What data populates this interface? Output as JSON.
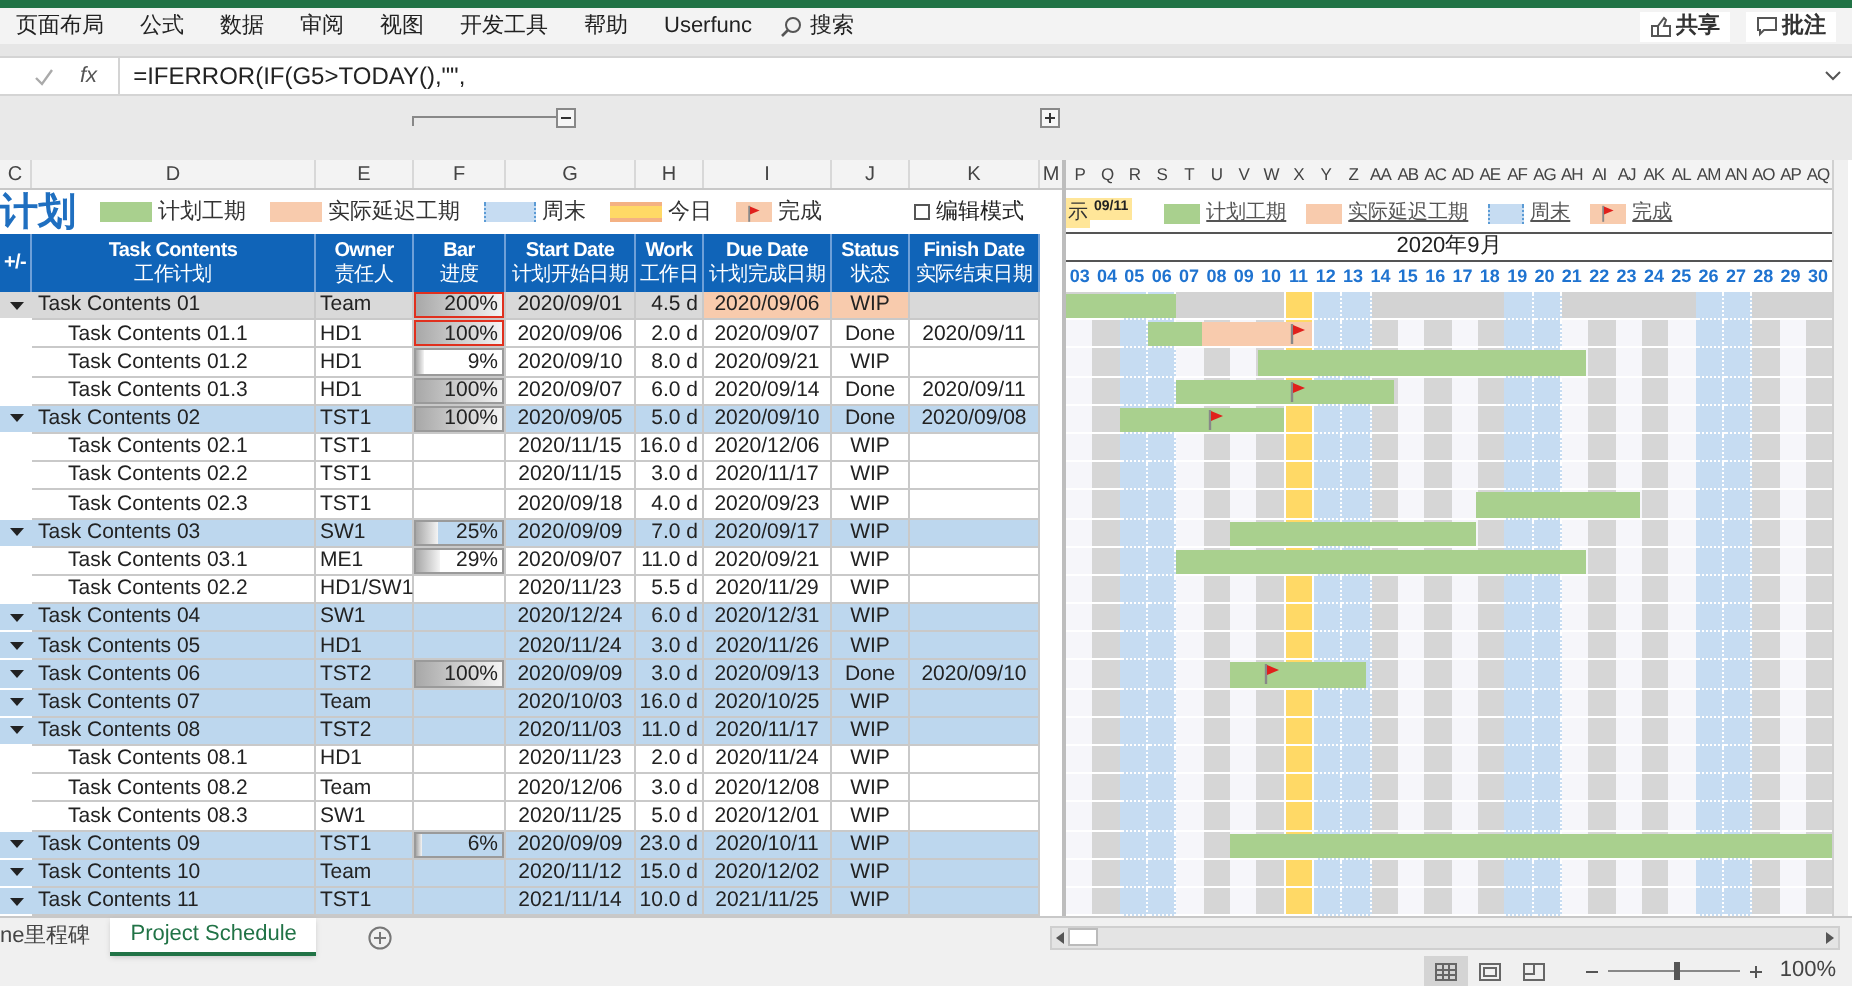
{
  "ribbon": {
    "tabs": [
      "页面布局",
      "公式",
      "数据",
      "审阅",
      "视图",
      "开发工具",
      "帮助",
      "Userfunc"
    ],
    "search": "搜索",
    "buttons": [
      {
        "kind": "share",
        "label": "共享"
      },
      {
        "kind": "comment",
        "label": "批注"
      }
    ]
  },
  "formula_bar": {
    "fx": "fx",
    "formula": "=IFERROR(IF(G5>TODAY(),\"\","
  },
  "column_headers": {
    "table": [
      "C",
      "D",
      "E",
      "F",
      "G",
      "H",
      "I",
      "J",
      "K"
    ],
    "spacer": "M",
    "gantt": [
      "P",
      "Q",
      "R",
      "S",
      "T",
      "U",
      "V",
      "W",
      "X",
      "Y",
      "Z",
      "AA",
      "AB",
      "AC",
      "AD",
      "AE",
      "AF",
      "AG",
      "AH",
      "AI",
      "AJ",
      "AK",
      "AL",
      "AM",
      "AN",
      "AO",
      "AP",
      "AQ"
    ]
  },
  "title": "计划",
  "legend": [
    {
      "kind": "plan",
      "label": "计划工期"
    },
    {
      "kind": "delay",
      "label": "实际延迟工期"
    },
    {
      "kind": "weekend",
      "label": "周末"
    },
    {
      "kind": "today",
      "label": "今日"
    },
    {
      "kind": "done",
      "label": "完成"
    }
  ],
  "edit_mode": {
    "label": "编辑模式",
    "checked": false
  },
  "table": {
    "columns": [
      {
        "en": "+/-"
      },
      {
        "en": "Task Contents",
        "zh": "工作计划"
      },
      {
        "en": "Owner",
        "zh": "责任人"
      },
      {
        "en": "Bar",
        "zh": "进度"
      },
      {
        "en": "Start Date",
        "zh": "计划开始日期"
      },
      {
        "en": "Work",
        "zh": "工作日"
      },
      {
        "en": "Due Date",
        "zh": "计划完成日期"
      },
      {
        "en": "Status",
        "zh": "状态"
      },
      {
        "en": "Finish Date",
        "zh": "实际结束日期"
      }
    ],
    "rows": [
      {
        "task": "Task Contents 01",
        "owner": "Team",
        "bar": {
          "text": "200%",
          "level": 1,
          "alert": true
        },
        "start": "2020/09/01",
        "work": "4.5 d",
        "due": "2020/09/06",
        "status": "WIP",
        "overdue": true,
        "selected": true,
        "children": [
          {
            "task": "Task Contents 01.1",
            "owner": "HD1",
            "bar": {
              "text": "100%",
              "level": 1,
              "alert": true
            },
            "start": "2020/09/06",
            "work": "2.0 d",
            "due": "2020/09/07",
            "status": "Done",
            "finish": "2020/09/11",
            "overdue": false,
            "selected": false
          },
          {
            "task": "Task Contents 01.2",
            "owner": "HD1",
            "bar": {
              "text": "9%",
              "level": 0.09,
              "alert": false
            },
            "start": "2020/09/10",
            "work": "8.0 d",
            "due": "2020/09/21",
            "status": "WIP",
            "overdue": false,
            "selected": false
          },
          {
            "task": "Task Contents 01.3",
            "owner": "HD1",
            "bar": {
              "text": "100%",
              "level": 1,
              "alert": false
            },
            "start": "2020/09/07",
            "work": "6.0 d",
            "due": "2020/09/14",
            "status": "Done",
            "finish": "2020/09/11",
            "overdue": false,
            "selected": false
          }
        ]
      },
      {
        "task": "Task Contents 02",
        "owner": "TST1",
        "bar": {
          "text": "100%",
          "level": 1,
          "alert": false
        },
        "start": "2020/09/05",
        "work": "5.0 d",
        "due": "2020/09/10",
        "status": "Done",
        "finish": "2020/09/08",
        "overdue": false,
        "selected": false,
        "children": [
          {
            "task": "Task Contents 02.1",
            "owner": "TST1",
            "start": "2020/11/15",
            "work": "16.0 d",
            "due": "2020/12/06",
            "status": "WIP",
            "overdue": false,
            "selected": false
          },
          {
            "task": "Task Contents 02.2",
            "owner": "TST1",
            "start": "2020/11/15",
            "work": "3.0 d",
            "due": "2020/11/17",
            "status": "WIP",
            "overdue": false,
            "selected": false
          },
          {
            "task": "Task Contents 02.3",
            "owner": "TST1",
            "start": "2020/09/18",
            "work": "4.0 d",
            "due": "2020/09/23",
            "status": "WIP",
            "overdue": false,
            "selected": false
          }
        ]
      },
      {
        "task": "Task Contents 03",
        "owner": "SW1",
        "bar": {
          "text": "25%",
          "level": 0.25,
          "alert": false
        },
        "start": "2020/09/09",
        "work": "7.0 d",
        "due": "2020/09/17",
        "status": "WIP",
        "overdue": false,
        "selected": false,
        "children": [
          {
            "task": "Task Contents 03.1",
            "owner": "ME1",
            "bar": {
              "text": "29%",
              "level": 0.29,
              "alert": false
            },
            "start": "2020/09/07",
            "work": "11.0 d",
            "due": "2020/09/21",
            "status": "WIP",
            "overdue": false,
            "selected": false
          },
          {
            "task": "Task Contents 02.2",
            "owner": "HD1/SW1",
            "start": "2020/11/23",
            "work": "5.5 d",
            "due": "2020/11/29",
            "status": "WIP",
            "overdue": false,
            "selected": false
          }
        ]
      },
      {
        "task": "Task Contents 04",
        "owner": "SW1",
        "start": "2020/12/24",
        "work": "6.0 d",
        "due": "2020/12/31",
        "status": "WIP",
        "overdue": false,
        "selected": false
      },
      {
        "task": "Task Contents 05",
        "owner": "HD1",
        "start": "2020/11/24",
        "work": "3.0 d",
        "due": "2020/11/26",
        "status": "WIP",
        "overdue": false,
        "selected": false
      },
      {
        "task": "Task Contents 06",
        "owner": "TST2",
        "bar": {
          "text": "100%",
          "level": 1,
          "alert": false
        },
        "start": "2020/09/09",
        "work": "3.0 d",
        "due": "2020/09/13",
        "status": "Done",
        "finish": "2020/09/10",
        "overdue": false,
        "selected": false
      },
      {
        "task": "Task Contents 07",
        "owner": "Team",
        "start": "2020/10/03",
        "work": "16.0 d",
        "due": "2020/10/25",
        "status": "WIP",
        "overdue": false,
        "selected": false
      },
      {
        "task": "Task Contents 08",
        "owner": "TST2",
        "start": "2020/11/03",
        "work": "11.0 d",
        "due": "2020/11/17",
        "status": "WIP",
        "overdue": false,
        "selected": false,
        "children": [
          {
            "task": "Task Contents 08.1",
            "owner": "HD1",
            "start": "2020/11/23",
            "work": "2.0 d",
            "due": "2020/11/24",
            "status": "WIP",
            "overdue": false,
            "selected": false
          },
          {
            "task": "Task Contents 08.2",
            "owner": "Team",
            "start": "2020/12/06",
            "work": "3.0 d",
            "due": "2020/12/08",
            "status": "WIP",
            "overdue": false,
            "selected": false
          },
          {
            "task": "Task Contents 08.3",
            "owner": "SW1",
            "start": "2020/11/25",
            "work": "5.0 d",
            "due": "2020/12/01",
            "status": "WIP",
            "overdue": false,
            "selected": false
          }
        ]
      },
      {
        "task": "Task Contents 09",
        "owner": "TST1",
        "bar": {
          "text": "6%",
          "level": 0.06,
          "alert": false
        },
        "start": "2020/09/09",
        "work": "23.0 d",
        "due": "2020/10/11",
        "status": "WIP",
        "overdue": false,
        "selected": false
      },
      {
        "task": "Task Contents 10",
        "owner": "Team",
        "start": "2020/11/12",
        "work": "15.0 d",
        "due": "2020/12/02",
        "status": "WIP",
        "overdue": false,
        "selected": false
      },
      {
        "task": "Task Contents 11",
        "owner": "TST1",
        "start": "2021/11/14",
        "work": "10.0 d",
        "due": "2021/11/25",
        "status": "WIP",
        "overdue": false,
        "selected": false
      }
    ]
  },
  "gantt": {
    "today_prefix": "示",
    "today_badge": "09/11",
    "legend": [
      {
        "kind": "plan",
        "label": "计划工期"
      },
      {
        "kind": "delay",
        "label": "实际延迟工期"
      },
      {
        "kind": "weekend",
        "label": "周末"
      },
      {
        "kind": "done",
        "label": "完成"
      }
    ],
    "month": "2020年9月",
    "days": [
      {
        "label": "03",
        "weekend": false,
        "today": false
      },
      {
        "label": "04",
        "weekend": false,
        "today": false
      },
      {
        "label": "05",
        "weekend": true,
        "today": false
      },
      {
        "label": "06",
        "weekend": true,
        "today": false
      },
      {
        "label": "07",
        "weekend": false,
        "today": false
      },
      {
        "label": "08",
        "weekend": false,
        "today": false
      },
      {
        "label": "09",
        "weekend": false,
        "today": false
      },
      {
        "label": "10",
        "weekend": false,
        "today": false
      },
      {
        "label": "11",
        "weekend": false,
        "today": true
      },
      {
        "label": "12",
        "weekend": true,
        "today": false
      },
      {
        "label": "13",
        "weekend": true,
        "today": false
      },
      {
        "label": "14",
        "weekend": false,
        "today": false
      },
      {
        "label": "15",
        "weekend": false,
        "today": false
      },
      {
        "label": "16",
        "weekend": false,
        "today": false
      },
      {
        "label": "17",
        "weekend": false,
        "today": false
      },
      {
        "label": "18",
        "weekend": false,
        "today": false
      },
      {
        "label": "19",
        "weekend": true,
        "today": false
      },
      {
        "label": "20",
        "weekend": true,
        "today": false
      },
      {
        "label": "21",
        "weekend": false,
        "today": false
      },
      {
        "label": "22",
        "weekend": false,
        "today": false
      },
      {
        "label": "23",
        "weekend": false,
        "today": false
      },
      {
        "label": "24",
        "weekend": false,
        "today": false
      },
      {
        "label": "25",
        "weekend": false,
        "today": false
      },
      {
        "label": "26",
        "weekend": true,
        "today": false
      },
      {
        "label": "27",
        "weekend": true,
        "today": false
      },
      {
        "label": "28",
        "weekend": false,
        "today": false
      },
      {
        "label": "29",
        "weekend": false,
        "today": false
      },
      {
        "label": "30",
        "weekend": false,
        "today": false
      }
    ]
  },
  "sheet_tabs": [
    {
      "label": "ne里程碑",
      "selected": false
    },
    {
      "label": "Project Schedule",
      "selected": true
    }
  ],
  "status_bar": {
    "views": [
      {
        "kind": "normal",
        "selected": true
      },
      {
        "kind": "layout",
        "selected": false
      },
      {
        "kind": "break",
        "selected": false
      }
    ],
    "zoom_slider": {
      "level": 0.5
    },
    "zoom": "100%"
  }
}
